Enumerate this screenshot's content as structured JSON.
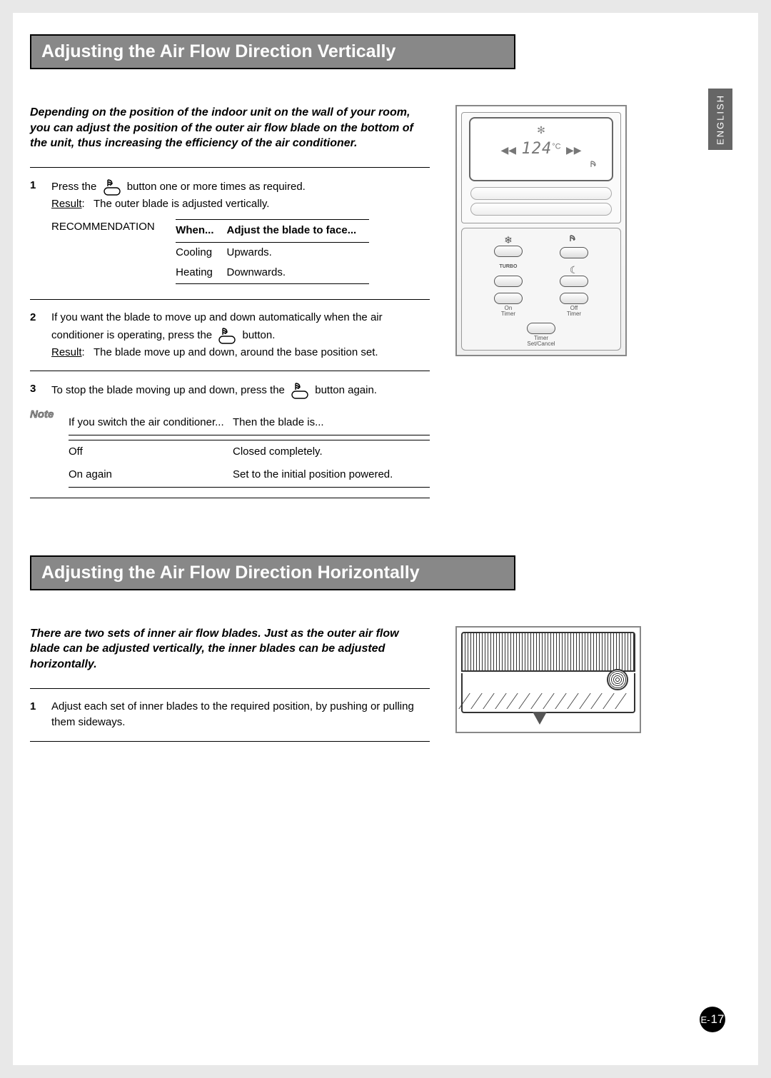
{
  "lang_tab": "ENGLISH",
  "section1": {
    "title": "Adjusting the Air Flow Direction Vertically",
    "intro": "Depending on the position of the indoor unit on the wall of your room, you can adjust the position of the outer air flow blade on the bottom of the unit, thus increasing the efficiency of the air conditioner.",
    "step1": {
      "num": "1",
      "pre": "Press the",
      "post": "button one or more times as required.",
      "result_label": "Result",
      "result_text": "The outer blade is adjusted vertically."
    },
    "rec": {
      "label": "RECOMMENDATION",
      "col1": "When...",
      "col2": "Adjust the blade to face...",
      "rows": [
        {
          "when": "Cooling",
          "adjust": "Upwards."
        },
        {
          "when": "Heating",
          "adjust": "Downwards."
        }
      ]
    },
    "step2": {
      "num": "2",
      "line1a": "If you want the blade to move up and down automatically when the air conditioner is operating, press the",
      "line1b": "button.",
      "result_label": "Result",
      "result_text": "The blade move up and down, around the base position set."
    },
    "step3": {
      "num": "3",
      "pre": "To stop the blade moving up and down, press the",
      "post": "button again."
    },
    "note": {
      "label": "Note",
      "head1": "If you switch the air conditioner...",
      "head2": "Then the blade is...",
      "rows": [
        {
          "a": "Off",
          "b": "Closed completely."
        },
        {
          "a": "On again",
          "b": "Set to the initial position powered."
        }
      ]
    }
  },
  "remote": {
    "temp": "124",
    "unit": "°C",
    "buttons": [
      {
        "icon": "snow",
        "label": ""
      },
      {
        "icon": "swing",
        "label": ""
      },
      {
        "icon": "turbo-text",
        "label": ""
      },
      {
        "icon": "sleep",
        "label": ""
      },
      {
        "icon": "",
        "label": "On\nTimer"
      },
      {
        "icon": "",
        "label": "Off\nTimer"
      },
      {
        "icon": "",
        "label": "Timer\nSet/Cancel"
      }
    ]
  },
  "section2": {
    "title": "Adjusting the Air Flow Direction Horizontally",
    "intro": "There are two sets of inner air flow blades. Just as the outer air flow blade can be adjusted vertically, the inner blades can be adjusted horizontally.",
    "step1": {
      "num": "1",
      "text": "Adjust each set of inner blades to the required position, by pushing or pulling them sideways."
    }
  },
  "page_prefix": "E-",
  "page_number": "17"
}
